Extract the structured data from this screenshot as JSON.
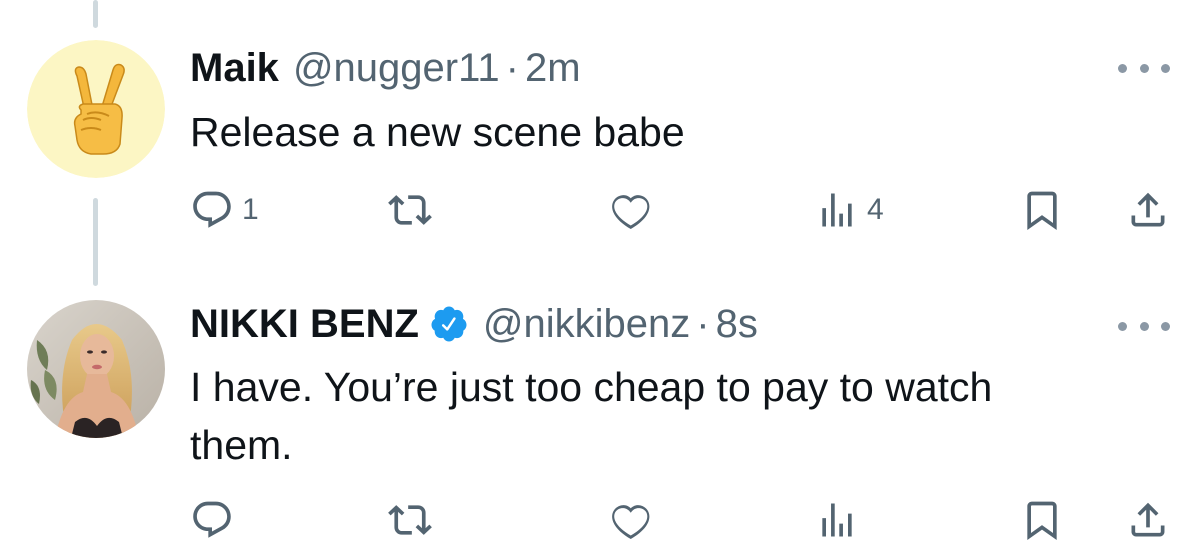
{
  "colors": {
    "secondary_text": "#536471",
    "icon": "#536471",
    "verified": "#1d9bf0",
    "thread_line": "#cfd9de"
  },
  "tweets": [
    {
      "author_name": "Maik",
      "handle": "@nugger11",
      "separator": "·",
      "time": "2m",
      "text": "Release a new scene babe",
      "avatar": "victory-hand-emoji-avatar",
      "verified": false,
      "actions": {
        "replies": "1",
        "retweets": "",
        "likes": "",
        "views": "4"
      }
    },
    {
      "author_name": "NIKKI BENZ",
      "handle": "@nikkibenz",
      "separator": "·",
      "time": "8s",
      "text_lines": [
        "I have. You’re just too cheap to pay to watch",
        "them."
      ],
      "avatar": "profile-photo-avatar",
      "verified": true,
      "actions": {
        "replies": "",
        "retweets": "",
        "likes": "",
        "views": ""
      }
    }
  ],
  "icons": [
    "reply-icon",
    "retweet-icon",
    "like-icon",
    "views-icon",
    "bookmark-icon",
    "share-icon",
    "more-options-icon",
    "verified-badge-icon"
  ]
}
